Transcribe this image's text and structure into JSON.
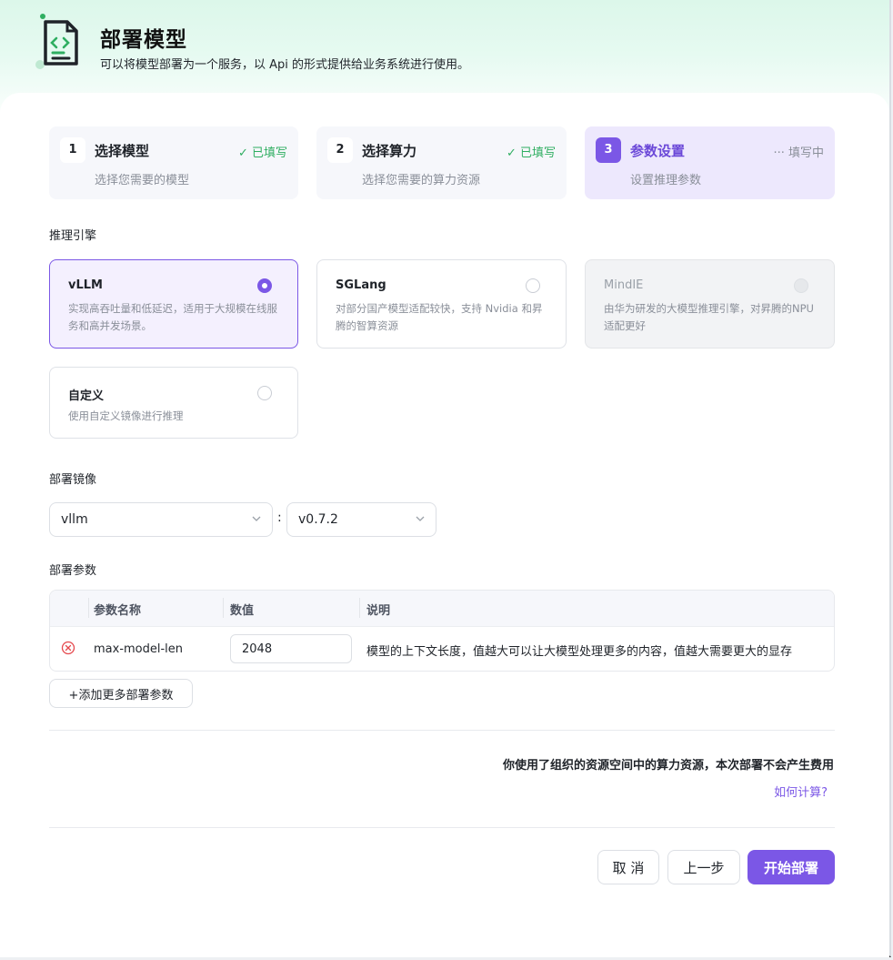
{
  "header": {
    "title": "部署模型",
    "subtitle": "可以将模型部署为一个服务，以 Api 的形式提供给业务系统进行使用。",
    "logo_icon": "code-document-icon"
  },
  "steps": [
    {
      "num": "1",
      "title": "选择模型",
      "desc": "选择您需要的模型",
      "status": "✓ 已填写"
    },
    {
      "num": "2",
      "title": "选择算力",
      "desc": "选择您需要的算力资源",
      "status": "✓ 已填写"
    },
    {
      "num": "3",
      "title": "参数设置",
      "desc": "设置推理参数",
      "status": "··· 填写中"
    }
  ],
  "engine": {
    "label": "推理引擎",
    "options": [
      {
        "name": "vLLM",
        "desc": "实现高吞吐量和低延迟，适用于大规模在线服务和高并发场景。",
        "selected": true
      },
      {
        "name": "SGLang",
        "desc": "对部分国产模型适配较快，支持 Nvidia 和昇腾的智算资源",
        "selected": false
      },
      {
        "name": "MindIE",
        "desc": "由华为研发的大模型推理引擎，对昇腾的NPU 适配更好",
        "selected": false,
        "disabled": true
      },
      {
        "name": "自定义",
        "desc": "使用自定义镜像进行推理",
        "selected": false
      }
    ]
  },
  "image": {
    "label": "部署镜像",
    "repo": "vllm",
    "separator": ":",
    "tag": "v0.7.2"
  },
  "params": {
    "label": "部署参数",
    "columns": [
      "参数名称",
      "数值",
      "说明"
    ],
    "rows": [
      {
        "name": "max-model-len",
        "value": "2048",
        "desc": "模型的上下文长度，值越大可以让大模型处理更多的内容，值越大需要更大的显存"
      }
    ],
    "add_label": "+添加更多部署参数"
  },
  "cost": {
    "notice": "你使用了组织的资源空间中的算力资源，本次部署不会产生费用",
    "link": "如何计算?"
  },
  "footer": {
    "cancel": "取 消",
    "prev": "上一步",
    "submit": "开始部署"
  },
  "colors": {
    "accent": "#7b57e6",
    "success": "#2fae61",
    "danger": "#e5484d"
  }
}
